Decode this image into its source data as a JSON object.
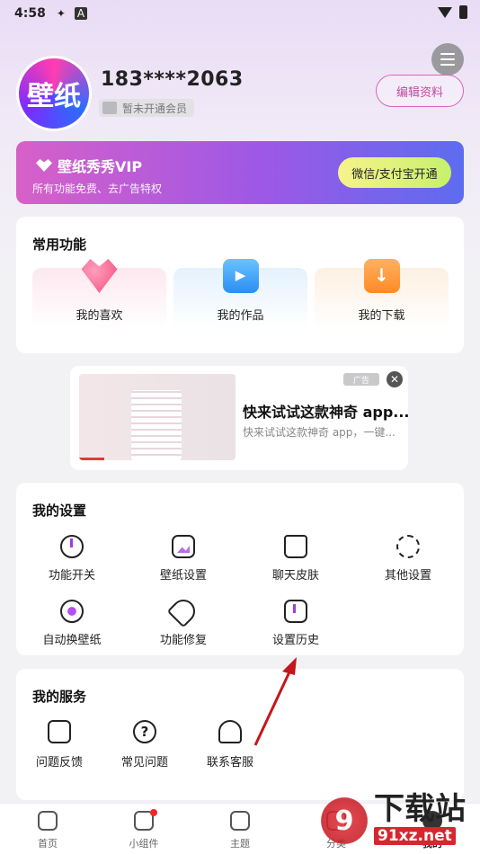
{
  "status_bar": {
    "time": "4:58",
    "icon_a": "A"
  },
  "profile": {
    "avatar_text": "壁纸",
    "phone": "183****2063",
    "vip_status": "暂未开通会员",
    "edit_button": "编辑资料"
  },
  "vip_banner": {
    "title": "壁纸秀秀VIP",
    "subtitle": "所有功能免费、去广告特权",
    "button": "微信/支付宝开通"
  },
  "common_functions": {
    "title": "常用功能",
    "items": [
      {
        "label": "我的喜欢",
        "icon": "heart-icon"
      },
      {
        "label": "我的作品",
        "icon": "video-icon"
      },
      {
        "label": "我的下载",
        "icon": "download-icon"
      }
    ]
  },
  "ad": {
    "tag": "广告",
    "title": "快来试试这款神奇 app...",
    "desc": "快来试试这款神奇 app，一键..."
  },
  "settings": {
    "title": "我的设置",
    "items": [
      {
        "label": "功能开关",
        "icon": "power-icon"
      },
      {
        "label": "壁纸设置",
        "icon": "image-icon"
      },
      {
        "label": "聊天皮肤",
        "icon": "shirt-icon"
      },
      {
        "label": "其他设置",
        "icon": "gear-icon"
      },
      {
        "label": "自动换壁纸",
        "icon": "auto-wallpaper-icon"
      },
      {
        "label": "功能修复",
        "icon": "wrench-icon"
      },
      {
        "label": "设置历史",
        "icon": "history-icon"
      }
    ]
  },
  "services": {
    "title": "我的服务",
    "items": [
      {
        "label": "问题反馈",
        "icon": "feedback-icon"
      },
      {
        "label": "常见问题",
        "icon": "question-icon"
      },
      {
        "label": "联系客服",
        "icon": "headset-icon"
      }
    ]
  },
  "tabbar": {
    "items": [
      {
        "label": "首页",
        "icon": "home-icon"
      },
      {
        "label": "小组件",
        "icon": "widget-icon"
      },
      {
        "label": "主题",
        "icon": "theme-icon"
      },
      {
        "label": "分类",
        "icon": "category-icon"
      },
      {
        "label": "我的",
        "icon": "profile-icon"
      }
    ]
  },
  "watermark": {
    "logo": "9",
    "text": "下载站",
    "url": "91xz.net"
  },
  "colors": {
    "accent": "#c04aa0",
    "vip_start": "#d760c8",
    "vip_end": "#5d6cf0",
    "arrow": "#c4161c"
  }
}
